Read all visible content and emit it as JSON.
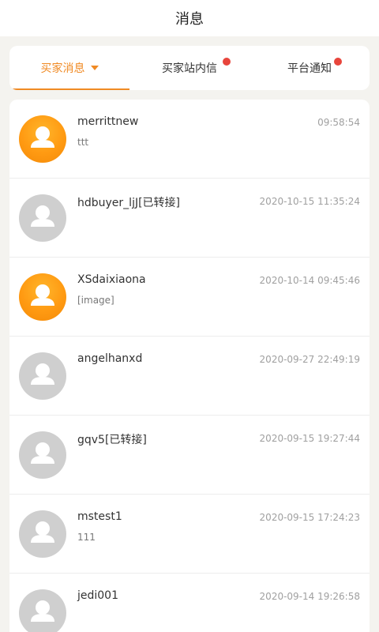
{
  "header": {
    "title": "消息"
  },
  "tabs": [
    {
      "label": "买家消息",
      "active": true,
      "dot": false,
      "caret": true
    },
    {
      "label": "买家站内信",
      "active": false,
      "dot": true,
      "caret": false
    },
    {
      "label": "平台通知",
      "active": false,
      "dot": true,
      "caret": false
    }
  ],
  "colors": {
    "accent": "#f08a24",
    "badge": "#e8453c",
    "avatar_orange": "#ff9a12",
    "avatar_grey": "#cfcfcf"
  },
  "messages": [
    {
      "name": "merrittnew",
      "time": "09:58:54",
      "preview": "ttt",
      "avatar": "orange"
    },
    {
      "name": "hdbuyer_ljJ[已转接]",
      "time": "2020-10-15 11:35:24",
      "preview": "",
      "avatar": "grey"
    },
    {
      "name": "XSdaixiaona",
      "time": "2020-10-14 09:45:46",
      "preview": "[image]",
      "avatar": "orange"
    },
    {
      "name": "angelhanxd",
      "time": "2020-09-27 22:49:19",
      "preview": "",
      "avatar": "grey"
    },
    {
      "name": "gqv5[已转接]",
      "time": "2020-09-15 19:27:44",
      "preview": "",
      "avatar": "grey"
    },
    {
      "name": "mstest1",
      "time": "2020-09-15 17:24:23",
      "preview": "111",
      "avatar": "grey"
    },
    {
      "name": "jedi001",
      "time": "2020-09-14 19:26:58",
      "preview": "",
      "avatar": "grey"
    }
  ]
}
